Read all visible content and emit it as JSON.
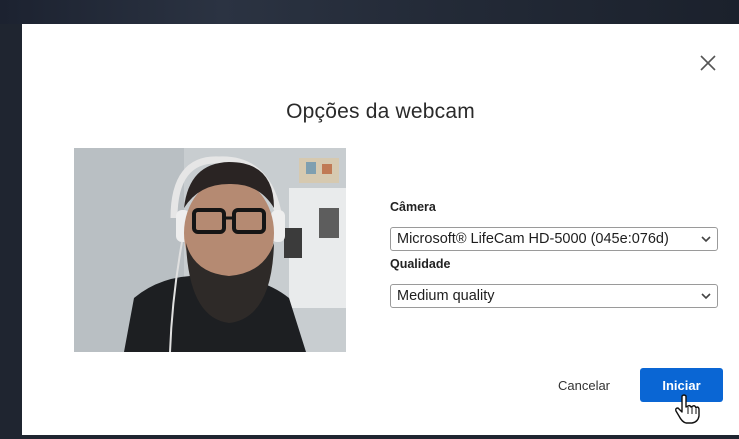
{
  "dialog": {
    "title": "Opções da webcam",
    "close_icon": "close-icon"
  },
  "camera": {
    "label": "Câmera",
    "selected": "Microsoft® LifeCam HD-5000 (045e:076d)"
  },
  "quality": {
    "label": "Qualidade",
    "selected": "Medium quality"
  },
  "actions": {
    "cancel_label": "Cancelar",
    "start_label": "Iniciar"
  },
  "colors": {
    "primary": "#0a66d4",
    "overlay": "#1f2530"
  },
  "icons": {
    "close": "close-icon",
    "dropdown": "chevron-down-icon",
    "pointer": "hand-pointer-icon"
  }
}
